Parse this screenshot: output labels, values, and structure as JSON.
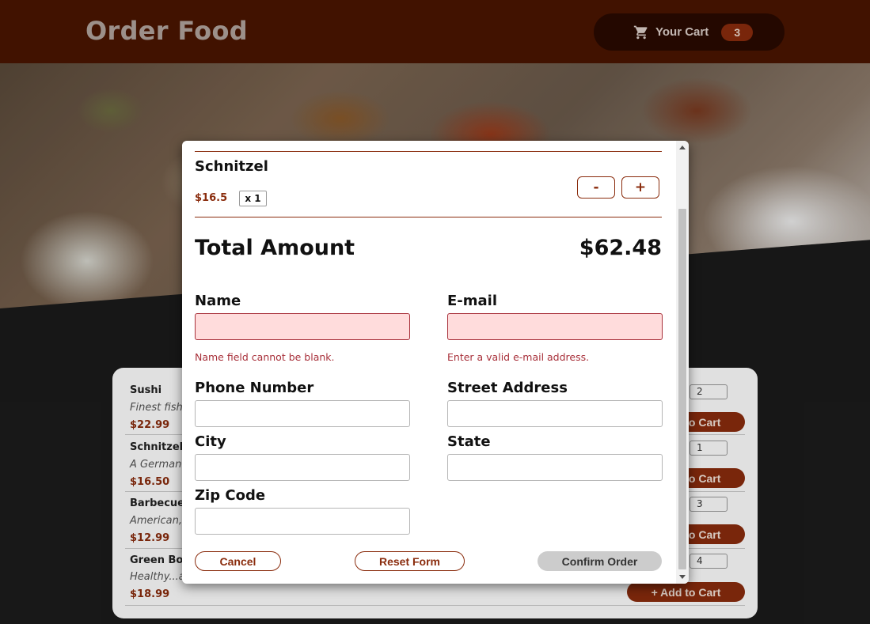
{
  "header": {
    "title": "Order Food",
    "cart_label": "Your Cart",
    "cart_count": "3"
  },
  "menu": {
    "items": [
      {
        "name": "Sushi",
        "desc": "Finest fish",
        "price": "$22.99",
        "qty": "2",
        "add_label": "+ Add to Cart"
      },
      {
        "name": "Schnitzel",
        "desc": "A German",
        "price": "$16.50",
        "qty": "1",
        "add_label": "+ Add to Cart"
      },
      {
        "name": "Barbecue",
        "desc": "American,",
        "price": "$12.99",
        "qty": "3",
        "add_label": "+ Add to Cart"
      },
      {
        "name": "Green Bowl",
        "desc": "Healthy...a",
        "price": "$18.99",
        "qty": "4",
        "add_label": "+ Add to Cart"
      }
    ]
  },
  "modal": {
    "cart_item": {
      "name": "Schnitzel",
      "price": "$16.5",
      "qty": "x 1",
      "minus": "-",
      "plus": "+"
    },
    "total_label": "Total Amount",
    "total_value": "$62.48",
    "form": {
      "name_label": "Name",
      "name_value": "",
      "name_error": "Name field cannot be blank.",
      "email_label": "E-mail",
      "email_value": "",
      "email_error": "Enter a valid e-mail address.",
      "phone_label": "Phone Number",
      "phone_value": "",
      "street_label": "Street Address",
      "street_value": "",
      "city_label": "City",
      "city_value": "",
      "state_label": "State",
      "state_value": "",
      "zip_label": "Zip Code",
      "zip_value": ""
    },
    "buttons": {
      "cancel": "Cancel",
      "reset": "Reset Form",
      "confirm": "Confirm Order"
    }
  },
  "colors": {
    "brand": "#4a1500",
    "accent": "#8a2c0d",
    "error": "#a8303a",
    "error_bg": "#ffdcdc"
  },
  "icons": {
    "cart": "shopping-cart-icon"
  }
}
